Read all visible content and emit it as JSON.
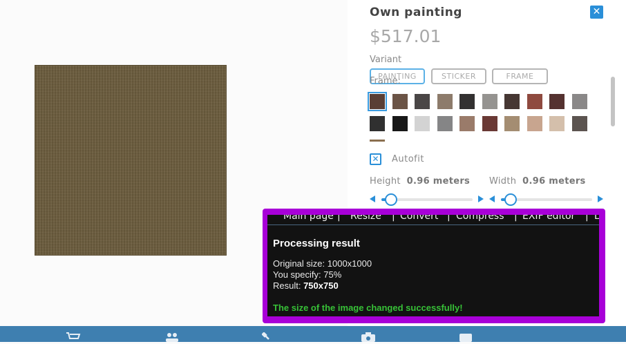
{
  "panel": {
    "title": "Own painting",
    "price": "$517.01",
    "variant_label": "Variant",
    "variants": [
      "PAINTING",
      "STICKER",
      "FRAME"
    ],
    "frame_label": "Frame:",
    "swatch_colors_row1": [
      "#5a3f35",
      "#6b5446",
      "#4a4646",
      "#8d7b6b",
      "#333131",
      "#959390",
      "#463733",
      "#8f4a3f",
      "#553230",
      "#8a8888"
    ],
    "swatch_colors_row2": [
      "#303030",
      "#181818",
      "#d3d3d3",
      "#858586",
      "#9a7b6a",
      "#6a3935",
      "#a48d72",
      "#c8a58f",
      "#d4bfab",
      "#5c5450"
    ],
    "autofit_label": "Autofit",
    "height_label": "Height",
    "height_value": "0.96 meters",
    "width_label": "Width",
    "width_value": "0.96 meters",
    "height_slider": 0.1,
    "width_slider": 0.1
  },
  "overlay": {
    "nav": [
      "Main page",
      "|",
      "Resize",
      "|",
      "Convert",
      "|",
      "Compress",
      "|",
      "EXIF editor",
      "|",
      "L"
    ],
    "title": "Processing result",
    "original_label": "Original size: ",
    "original_value": "1000x1000",
    "specify_label": "You specify: ",
    "specify_value": "75%",
    "result_label": "Result: ",
    "result_value": "750x750",
    "success": "The size of the image changed successfully!"
  },
  "bottombar": {
    "icons": [
      "cart-icon",
      "users-icon",
      "wrench-icon",
      "camera-icon",
      "box-icon"
    ],
    "accent": "#3e7fb0"
  }
}
